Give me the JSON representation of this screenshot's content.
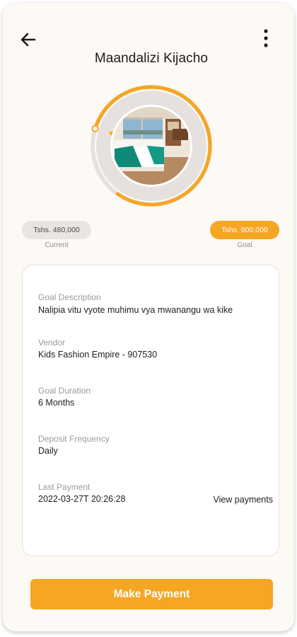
{
  "header": {
    "title": "Maandalizi Kijacho",
    "back_icon": "arrow-left-icon",
    "menu_icon": "more-vertical-icon"
  },
  "goal": {
    "image": "bedroom-photo",
    "progress_fraction": 0.8,
    "current_amount": "Tshs. 480,000",
    "current_caption": "Current",
    "goal_amount": "Tshs. 600,000",
    "goal_caption": "Goal"
  },
  "details": {
    "description_label": "Goal Description",
    "description_value": "Nalipia vitu vyote muhimu vya mwanangu wa kike",
    "vendor_label": "Vendor",
    "vendor_value": "Kids Fashion Empire - 907530",
    "duration_label": "Goal Duration",
    "duration_value": "6 Months",
    "frequency_label": "Deposit Frequency",
    "frequency_value": "Daily",
    "last_payment_label": "Last Payment",
    "last_payment_value": "2022-03-27T 20:26:28",
    "view_payments_label": "View payments"
  },
  "actions": {
    "make_payment_label": "Make Payment"
  },
  "colors": {
    "accent": "#f5a623",
    "background": "#fdf9f5",
    "ring_track": "#e6e1de"
  }
}
